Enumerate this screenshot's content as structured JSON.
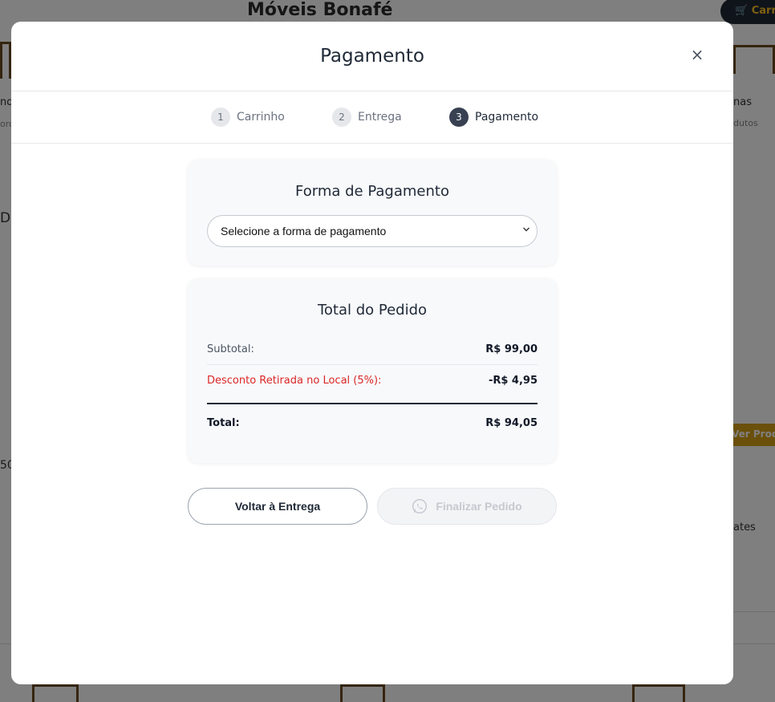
{
  "background": {
    "brand": "Móveis Bonafé",
    "cart_label": "🛒 Carr",
    "fragment_left_1": "nq",
    "fragment_left_2": "oro",
    "fragment_left_3": "Di",
    "fragment_left_4": "50",
    "fragment_right_1": "nas",
    "fragment_right_2": "dutos",
    "fragment_right_3": "Ver Prod",
    "fragment_right_4": "ates"
  },
  "modal": {
    "title": "Pagamento",
    "close_symbol": "×"
  },
  "steps": [
    {
      "number": "1",
      "label": "Carrinho",
      "active": false
    },
    {
      "number": "2",
      "label": "Entrega",
      "active": false
    },
    {
      "number": "3",
      "label": "Pagamento",
      "active": true
    }
  ],
  "payment": {
    "title": "Forma de Pagamento",
    "select_value": "Selecione a forma de pagamento"
  },
  "order": {
    "title": "Total do Pedido",
    "subtotal_label": "Subtotal:",
    "subtotal_value": "R$ 99,00",
    "discount_label": "Desconto Retirada no Local (5%):",
    "discount_value": "-R$ 4,95",
    "total_label": "Total:",
    "total_value": "R$ 94,05"
  },
  "buttons": {
    "back_label": "Voltar à Entrega",
    "finish_label": "Finalizar Pedido",
    "finish_icon": "whatsapp-icon"
  },
  "colors": {
    "discount_red": "#dc2626",
    "active_step": "#374151",
    "overlay": "rgba(0,0,0,0.5)"
  }
}
